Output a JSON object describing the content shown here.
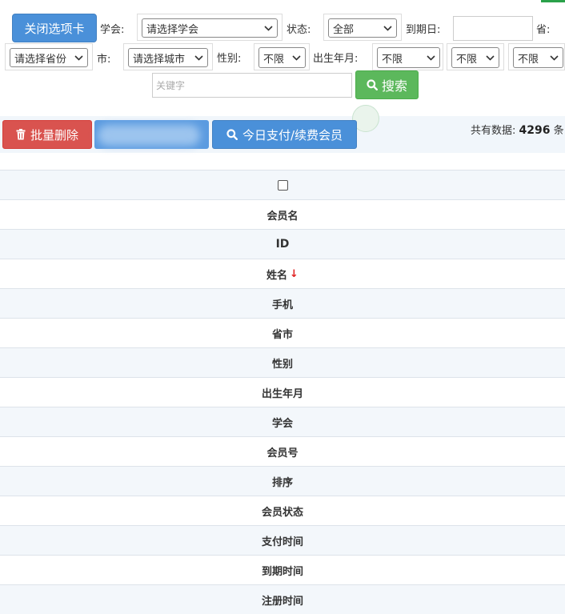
{
  "filters": {
    "close_tab_label": "关闭选项卡",
    "society_label": "学会:",
    "society_select": "请选择学会",
    "status_label": "状态:",
    "status_select": "全部",
    "expiry_label": "到期日:",
    "expiry_value": "",
    "province_label": "省:",
    "province_select": "请选择省份",
    "city_label": "市:",
    "city_select": "请选择城市",
    "gender_label": "性别:",
    "gender_select": "不限",
    "birth_label": "出生年月:",
    "birth_select_1": "不限",
    "birth_select_2": "不限",
    "birth_select_3": "不限",
    "keyword_placeholder": "关键字",
    "search_label": "搜索"
  },
  "toolbar": {
    "batch_delete_label": "批量删除",
    "today_paid_label": "今日支付/续费会员",
    "total_label": "共有数据:",
    "total_count": "4296",
    "total_suffix": "条"
  },
  "table": {
    "columns": [
      "会员名",
      "ID",
      "姓名",
      "手机",
      "省市",
      "性别",
      "出生年月",
      "学会",
      "会员号",
      "排序",
      "会员状态",
      "支付时间",
      "到期时间",
      "注册时间"
    ],
    "sort_indicator": "↓"
  },
  "colors": {
    "primary": "#4a90d9",
    "success": "#5cb85c",
    "danger": "#d9534f"
  }
}
